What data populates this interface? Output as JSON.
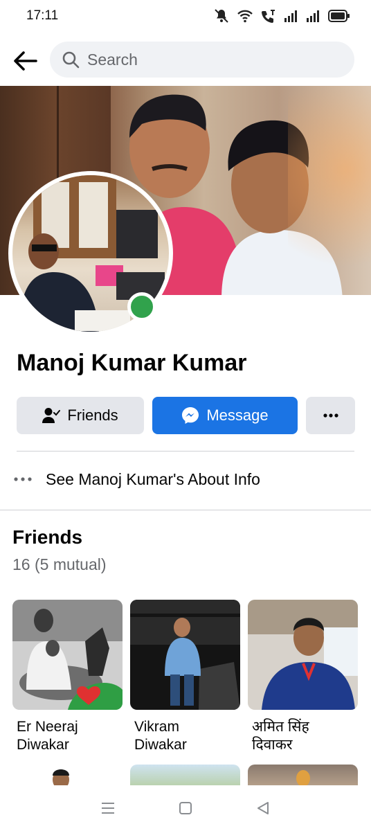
{
  "status_bar": {
    "time": "17:11",
    "icons": [
      "mute-icon",
      "wifi-icon",
      "volte-call-icon",
      "signal-icon",
      "signal-icon",
      "battery-icon"
    ]
  },
  "header": {
    "back_icon": "arrow-left-icon",
    "search_placeholder": "Search",
    "search_icon": "search-icon"
  },
  "profile": {
    "name": "Manoj Kumar Kumar",
    "online": true,
    "status_color": "#31a24c"
  },
  "actions": {
    "friends_label": "Friends",
    "friends_icon": "person-check-icon",
    "message_label": "Message",
    "message_icon": "messenger-icon",
    "more_icon": "more-dots-icon"
  },
  "about": {
    "label": "See Manoj Kumar's About Info",
    "icon": "more-dots-icon"
  },
  "friends": {
    "title": "Friends",
    "count": "16 (5 mutual)",
    "items": [
      {
        "line1": "Er Neeraj",
        "line2": "Diwakar"
      },
      {
        "line1": "Vikram",
        "line2": "Diwakar"
      },
      {
        "line1": "अमित सिंह",
        "line2": "दिवाकर"
      }
    ]
  },
  "nav": {
    "icons": [
      "menu-icon",
      "home-square-icon",
      "back-triangle-icon"
    ]
  },
  "colors": {
    "accent": "#1b74e4",
    "button_gray": "#e4e6eb",
    "search_bg": "#f0f2f5",
    "secondary_text": "#65676b"
  }
}
